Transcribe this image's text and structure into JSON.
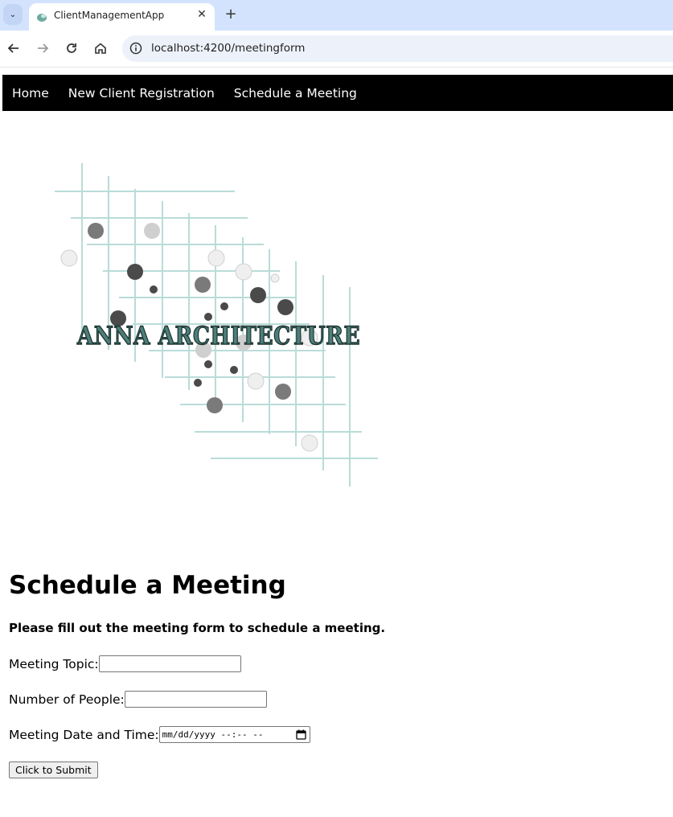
{
  "browser": {
    "tab_title": "ClientManagementApp",
    "url": "localhost:4200/meetingform"
  },
  "nav": {
    "items": [
      {
        "label": "Home"
      },
      {
        "label": "New Client Registration"
      },
      {
        "label": "Schedule a Meeting"
      }
    ]
  },
  "logo": {
    "text": "ANNA ARCHITECTURE",
    "line_color": "#b9dcd8",
    "dot_colors": [
      "#4a4a4a",
      "#7a7a7a",
      "#cfcfcf",
      "#efefef"
    ]
  },
  "main": {
    "title": "Schedule a Meeting",
    "subtitle": "Please fill out the meeting form to schedule a meeting.",
    "fields": [
      {
        "label": "Meeting Topic:",
        "value": ""
      },
      {
        "label": "Number of People:",
        "value": ""
      },
      {
        "label": "Meeting Date and Time:",
        "placeholder": "mm/dd/yyyy --:-- --"
      }
    ],
    "submit_label": "Click to Submit"
  }
}
